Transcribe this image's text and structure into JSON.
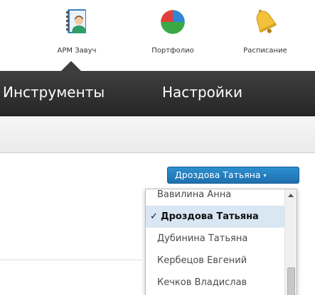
{
  "apps": [
    {
      "label": "АРМ Завуч",
      "icon": "teacher-workstation-icon"
    },
    {
      "label": "Портфолио",
      "icon": "portfolio-pie-icon"
    },
    {
      "label": "Расписание",
      "icon": "schedule-bell-icon"
    }
  ],
  "nav": {
    "tools": "Инструменты",
    "settings": "Настройки"
  },
  "user_select": {
    "value": "Дроздова Татьяна",
    "caret": "▾",
    "color": "#2380c0"
  },
  "dropdown": {
    "items": [
      "Вавилина Анна",
      "Дроздова Татьяна",
      "Дубинина Татьяна",
      "Кербецов Евгений",
      "Кечков Владислав"
    ],
    "selected_index": 1,
    "check_mark": "✓"
  }
}
